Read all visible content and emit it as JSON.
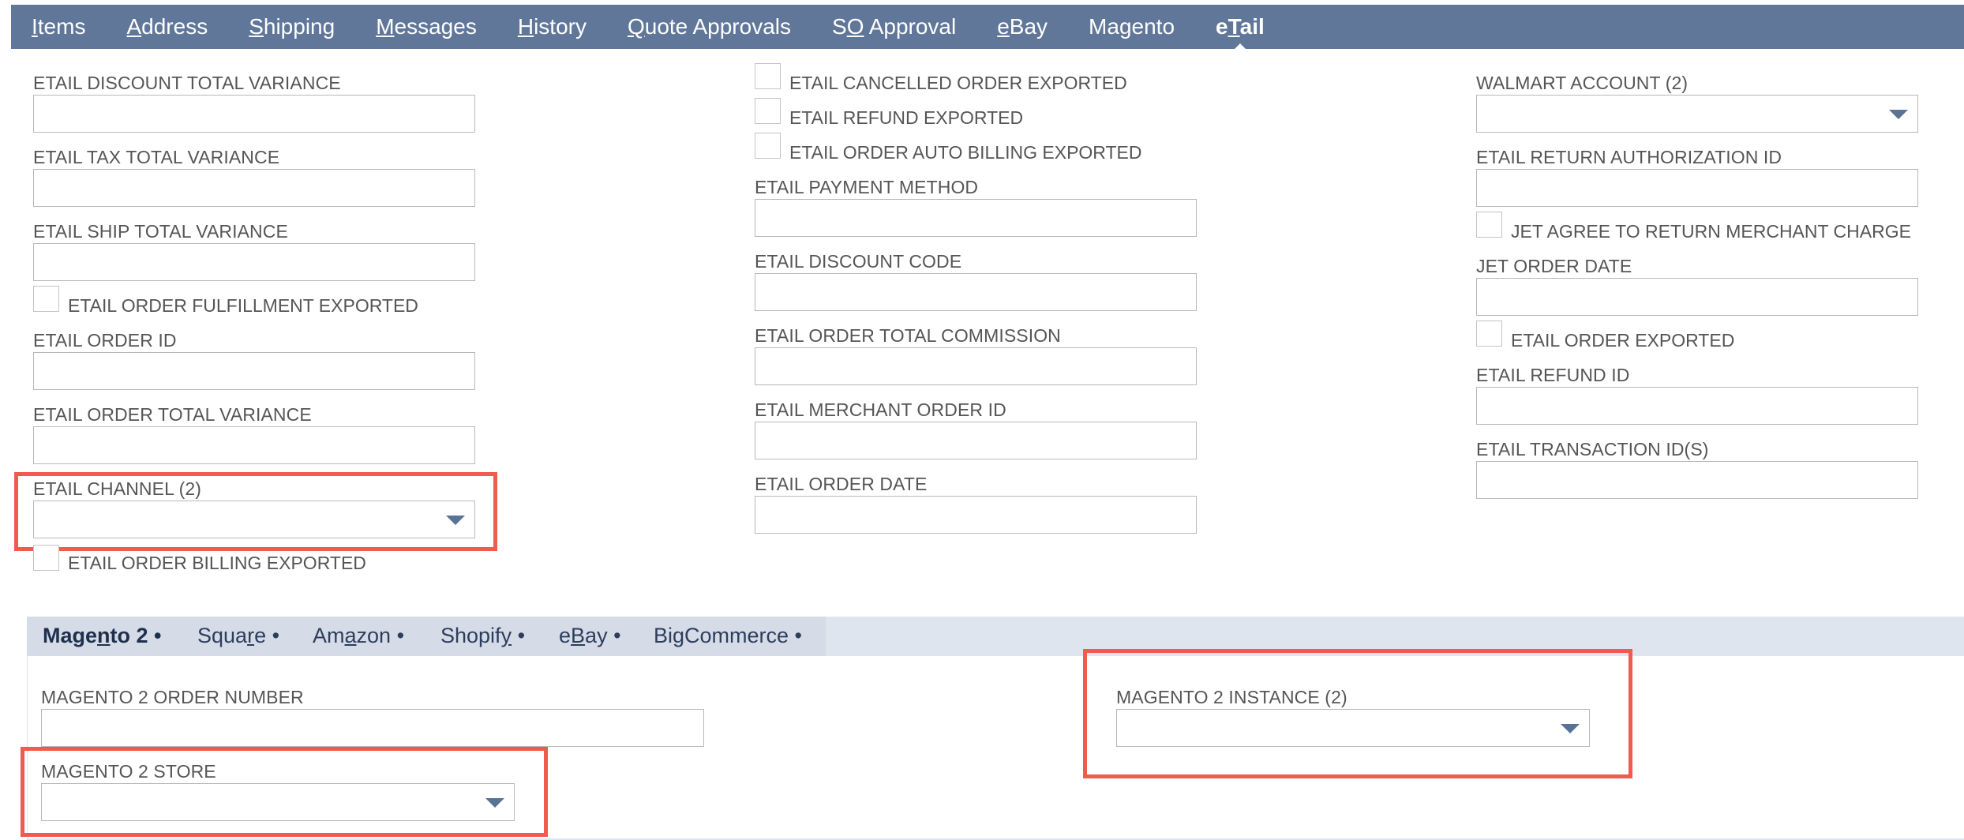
{
  "tabs": [
    {
      "acc": "I",
      "rest": "tems",
      "pre": ""
    },
    {
      "acc": "A",
      "rest": "ddress",
      "pre": ""
    },
    {
      "acc": "S",
      "rest": "hipping",
      "pre": ""
    },
    {
      "acc": "M",
      "rest": "essages",
      "pre": ""
    },
    {
      "acc": "H",
      "rest": "istory",
      "pre": ""
    },
    {
      "acc": "Q",
      "rest": "uote Approvals",
      "pre": ""
    },
    {
      "acc": "O",
      "rest": " Approval",
      "pre": "S"
    },
    {
      "acc": "e",
      "rest": "Bay",
      "pre": ""
    },
    {
      "acc": "",
      "rest": "Magento",
      "pre": ""
    },
    {
      "acc": "T",
      "rest": "ail",
      "pre": "e"
    }
  ],
  "left": {
    "discount_total_variance": "ETAIL DISCOUNT TOTAL VARIANCE",
    "tax_total_variance": "ETAIL TAX TOTAL VARIANCE",
    "ship_total_variance": "ETAIL SHIP TOTAL VARIANCE",
    "order_fulfillment_exported": "ETAIL ORDER FULFILLMENT EXPORTED",
    "order_id": "ETAIL ORDER ID",
    "order_total_variance": "ETAIL ORDER TOTAL VARIANCE",
    "channel": "ETAIL CHANNEL (2)",
    "order_billing_exported": "ETAIL ORDER BILLING EXPORTED"
  },
  "middle": {
    "cancelled_order_exported": "ETAIL CANCELLED ORDER EXPORTED",
    "refund_exported": "ETAIL REFUND EXPORTED",
    "order_auto_billing_exported": "ETAIL ORDER AUTO BILLING EXPORTED",
    "payment_method": "ETAIL PAYMENT METHOD",
    "discount_code": "ETAIL DISCOUNT CODE",
    "order_total_commission": "ETAIL ORDER TOTAL COMMISSION",
    "merchant_order_id": "ETAIL MERCHANT ORDER ID",
    "order_date": "ETAIL ORDER DATE"
  },
  "right": {
    "walmart_account": "WALMART ACCOUNT (2)",
    "return_authorization_id": "ETAIL RETURN AUTHORIZATION ID",
    "jet_agree_return": "JET AGREE TO RETURN MERCHANT CHARGE",
    "jet_order_date": "JET ORDER DATE",
    "order_exported": "ETAIL ORDER EXPORTED",
    "refund_id": "ETAIL REFUND ID",
    "transaction_ids": "ETAIL TRANSACTION ID(S)"
  },
  "subtabs": [
    {
      "pre": "Mage",
      "acc": "n",
      "rest": "to 2 •"
    },
    {
      "pre": "Squa",
      "acc": "r",
      "rest": "e •"
    },
    {
      "pre": "Am",
      "acc": "a",
      "rest": "zon •"
    },
    {
      "pre": "Shopif",
      "acc": "y",
      "rest": " •"
    },
    {
      "pre": "e",
      "acc": "B",
      "rest": "ay •"
    },
    {
      "pre": "BigCommerce •",
      "acc": "",
      "rest": ""
    }
  ],
  "magento": {
    "order_number": "MAGENTO 2 ORDER NUMBER",
    "store": "MAGENTO 2 STORE",
    "instance": "MAGENTO 2 INSTANCE (2)"
  },
  "colors": {
    "topbar": "#607799",
    "highlight": "#f05a4f",
    "subbar": "#dfe5ef",
    "caret": "#5a7296"
  }
}
